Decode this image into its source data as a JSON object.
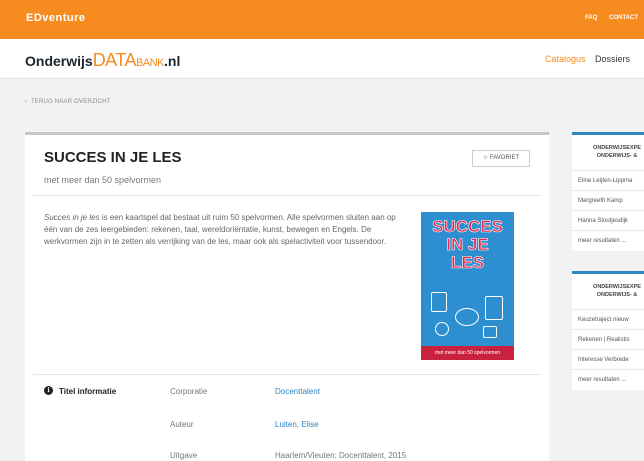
{
  "topbar": {
    "brand": "EDventure",
    "links": [
      "FAQ",
      "CONTACT"
    ]
  },
  "header": {
    "logo_a": "Onderwijs",
    "logo_db": "DATA",
    "logo_bank": "BANK",
    "logo_nl": ".nl",
    "nav": [
      "Catalogus",
      "Dossiers"
    ]
  },
  "back_link": "TERUG NAAR OVERZICHT",
  "item": {
    "title": "SUCCES IN JE LES",
    "subtitle": "met meer dan 50 spelvormen",
    "favorite_label": "FAVORIET",
    "description_em": "Succes in je les",
    "description_rest": " is een kaartspel dat bestaat uit ruim 50 spelvormen. Alle spelvormen sluiten aan op één van de zes leergebieden: rekenen, taal, wereldoriëntatie, kunst, bewegen en Engels. De werkvormen zijn in te zetten als verrijking van de les, maar ook als spelactiviteit voor tussendoor.",
    "cover_title_1": "SUCCES",
    "cover_title_2": "IN JE",
    "cover_title_3": "LES",
    "cover_band": "met meer dan 50 spelvormen"
  },
  "info": {
    "heading": "Titel informatie",
    "rows": [
      {
        "label": "Corporatie",
        "value": "Docenttalent"
      },
      {
        "label": "Auteur",
        "value": "Luiten, Elise"
      },
      {
        "label": "Uitgave",
        "value": "Haarlem/Vleuten: Docenttalent, 2015"
      }
    ]
  },
  "sidebar": [
    {
      "heading_1": "ONDERWIJSEXPE",
      "heading_2": "ONDERWIJS- &",
      "items": [
        "Eline Leijten-Lippma",
        "Margreeth Kamp",
        "Hanna Stoutjesdijk",
        "meer resultaten ..."
      ]
    },
    {
      "heading_1": "ONDERWIJSEXPE",
      "heading_2": "ONDERWIJS- &",
      "items": [
        "Keuzetraject nieuw",
        "Rekenen | Realistis",
        "Interesse Verbrede",
        "meer resultaten ..."
      ]
    }
  ],
  "colors": {
    "accent": "#f68b1f",
    "link": "#2e86c1",
    "cover": "#2d8fcf",
    "cover_band": "#c9223f"
  }
}
